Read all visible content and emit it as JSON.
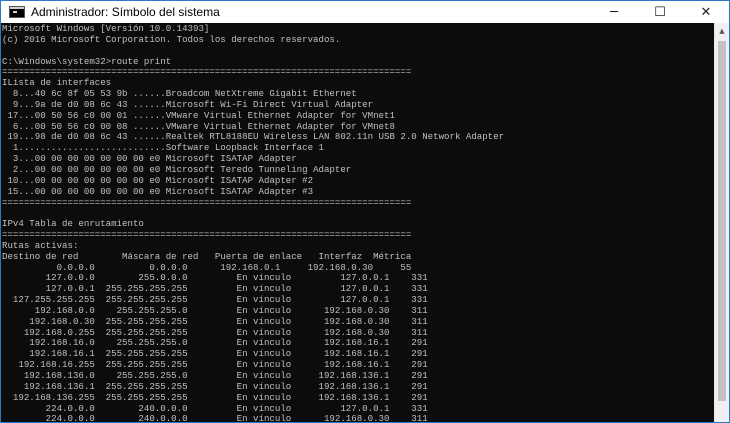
{
  "window": {
    "title": "Administrador: Símbolo del sistema",
    "icon": "cmd-icon",
    "buttons": {
      "minimize": "─",
      "maximize": "☐",
      "close": "✕"
    }
  },
  "console": {
    "lines": [
      "Microsoft Windows [Versión 10.0.14393]",
      "(c) 2016 Microsoft Corporation. Todos los derechos reservados.",
      "",
      "C:\\Windows\\system32>route print",
      "===========================================================================",
      "ILista de interfaces",
      "  8...40 6c 8f 05 53 9b ......Broadcom NetXtreme Gigabit Ethernet",
      "  9...9a de d0 08 6c 43 ......Microsoft Wi-Fi Direct Virtual Adapter",
      " 17...00 50 56 c0 00 01 ......VMware Virtual Ethernet Adapter for VMnet1",
      "  6...00 50 56 c0 00 08 ......VMware Virtual Ethernet Adapter for VMnet8",
      " 19...98 de d0 08 6c 43 ......Realtek RTL8188EU Wireless LAN 802.11n USB 2.0 Network Adapter",
      "  1...........................Software Loopback Interface 1",
      "  3...00 00 00 00 00 00 00 e0 Microsoft ISATAP Adapter",
      "  2...00 00 00 00 00 00 00 e0 Microsoft Teredo Tunneling Adapter",
      " 10...00 00 00 00 00 00 00 e0 Microsoft ISATAP Adapter #2",
      " 15...00 00 00 00 00 00 00 e0 Microsoft ISATAP Adapter #3",
      "===========================================================================",
      "",
      "IPv4 Tabla de enrutamiento",
      "===========================================================================",
      "Rutas activas:",
      "Destino de red        Máscara de red   Puerta de enlace   Interfaz  Métrica",
      "          0.0.0.0          0.0.0.0      192.168.0.1     192.168.0.30     55",
      "        127.0.0.0        255.0.0.0         En vínculo         127.0.0.1    331",
      "        127.0.0.1  255.255.255.255         En vínculo         127.0.0.1    331",
      "  127.255.255.255  255.255.255.255         En vínculo         127.0.0.1    331",
      "      192.168.0.0    255.255.255.0         En vínculo      192.168.0.30    311",
      "     192.168.0.30  255.255.255.255         En vínculo      192.168.0.30    311",
      "    192.168.0.255  255.255.255.255         En vínculo      192.168.0.30    311",
      "     192.168.16.0    255.255.255.0         En vínculo      192.168.16.1    291",
      "     192.168.16.1  255.255.255.255         En vínculo      192.168.16.1    291",
      "   192.168.16.255  255.255.255.255         En vínculo      192.168.16.1    291",
      "    192.168.136.0    255.255.255.0         En vínculo     192.168.136.1    291",
      "    192.168.136.1  255.255.255.255         En vínculo     192.168.136.1    291",
      "  192.168.136.255  255.255.255.255         En vínculo     192.168.136.1    291",
      "        224.0.0.0        240.0.0.0         En vínculo         127.0.0.1    331",
      "        224.0.0.0        240.0.0.0         En vínculo      192.168.0.30    311"
    ]
  }
}
